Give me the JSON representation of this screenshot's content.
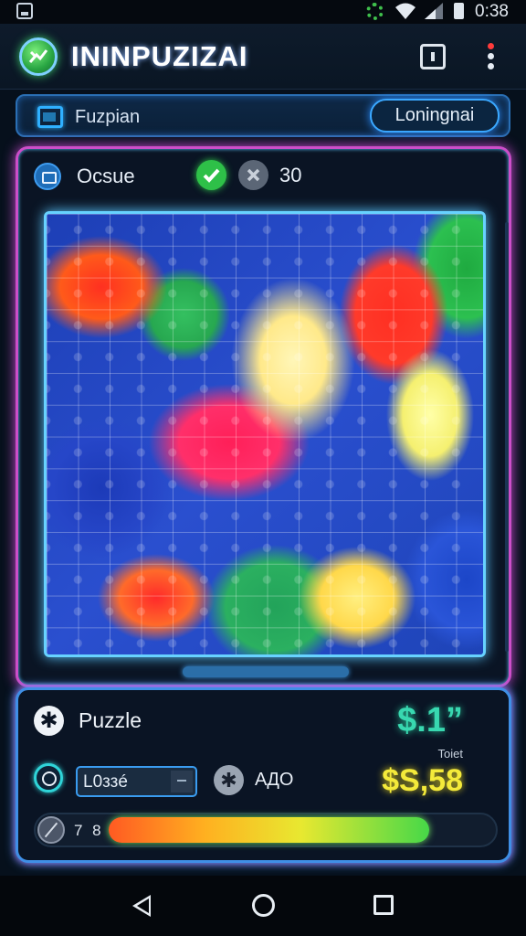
{
  "status_bar": {
    "time": "0:38"
  },
  "app_bar": {
    "title": "ININPUZIZAI"
  },
  "search": {
    "label": "Fuzpian",
    "button_label": "Loningnai"
  },
  "puzzle_panel": {
    "title": "Ocsue",
    "count": "30"
  },
  "info_panel": {
    "title": "Puzzle",
    "price": "$.1”",
    "price_label": "Toiet",
    "dropdown_value": "L0ззé",
    "add_label": "AДO",
    "total": "$S,58",
    "progress_text": "7 8",
    "progress_level": 0.84
  },
  "colors": {
    "accent_magenta": "#cc4ec9",
    "accent_blue": "#3f8fe6",
    "price_teal": "#38d8b0",
    "total_yellow": "#f4ea3a",
    "check_green": "#2ec048"
  },
  "icons": {
    "status": [
      "screenshot-icon",
      "gear-icon",
      "wifi-icon",
      "signal-icon",
      "battery-icon"
    ],
    "app": [
      "app-logo-icon",
      "square-button-icon",
      "more-menu-icon"
    ],
    "panel": [
      "robot-icon",
      "check-icon",
      "close-icon"
    ],
    "info": [
      "star-icon",
      "lock-icon",
      "add-icon",
      "brush-icon"
    ],
    "nav": [
      "back-icon",
      "home-icon",
      "recents-icon"
    ]
  }
}
